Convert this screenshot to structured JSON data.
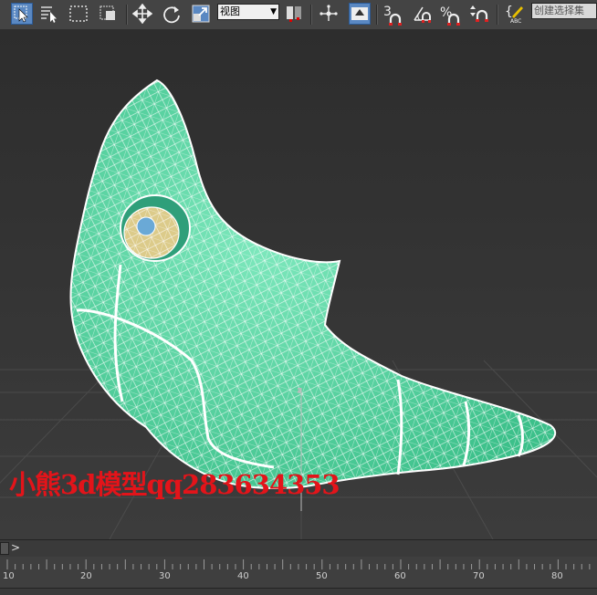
{
  "toolbar": {
    "reference_coordinate_system": "视图",
    "named_selection_sets": "创建选择集",
    "snap_toggle_label": "3",
    "percent_snap_label": "%"
  },
  "viewport": {
    "watermark": "小熊3d模型qq283634353"
  },
  "timeslider": {
    "next_label": ">"
  },
  "trackbar": {
    "ticks": [
      "10",
      "20",
      "30",
      "40",
      "50",
      "60",
      "70",
      "80"
    ]
  },
  "colors": {
    "toolbar_bg": "#444444",
    "active_button": "#5a88c2",
    "mesh_fill": "#4fd8a0",
    "wire": "#ffffff",
    "eye_fill": "#dccb8a",
    "watermark": "#e3141a"
  },
  "icons": [
    "select-object-icon",
    "select-by-name-icon",
    "rectangular-region-icon",
    "window-crossing-icon",
    "move-icon",
    "rotate-icon",
    "scale-icon",
    "pivot-icon",
    "manipulate-icon",
    "keyboard-shortcut-icon",
    "snap-toggle-icon",
    "angle-snap-icon",
    "percent-snap-icon",
    "spinner-snap-icon",
    "edit-named-sets-icon"
  ]
}
